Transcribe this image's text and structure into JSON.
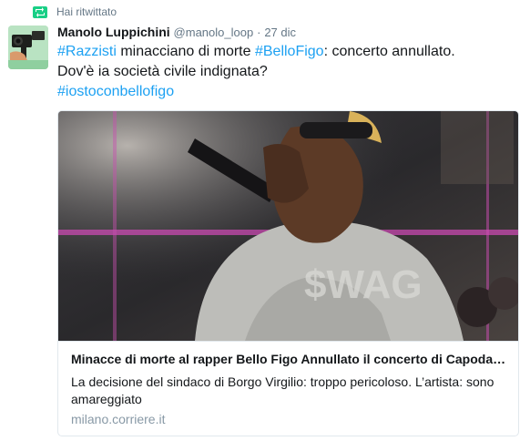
{
  "retweet": {
    "label": "Hai ritwittato",
    "icon": "retweet-icon"
  },
  "tweet": {
    "author_name": "Manolo Luppichini",
    "author_handle": "@manolo_loop",
    "separator": "·",
    "timestamp": "27 dic",
    "text": {
      "hashtag1": "#Razzisti",
      "part1": " minacciano di morte ",
      "hashtag2": "#BelloFigo",
      "part2": ": concerto annullato.",
      "line2": "Dov'è ia società civile indignata?",
      "hashtag3": "#iostoconbellofigo"
    }
  },
  "card": {
    "title": "Minacce di morte al rapper Bello Figo Annullato il concerto di Capodanno",
    "description": "La decisione del sindaco di Borgo Virgilio: troppo pericoloso. L’artista: sono amareggiato",
    "domain": "milano.corriere.it",
    "image_text": "$WAG"
  },
  "colors": {
    "link": "#1da1f2",
    "muted": "#657786",
    "retweet": "#19cf86"
  }
}
